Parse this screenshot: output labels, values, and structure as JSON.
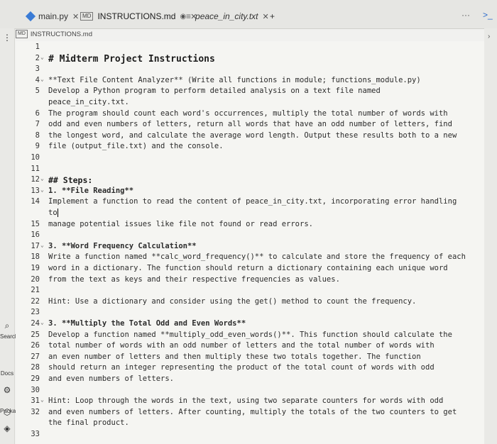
{
  "tabs": [
    {
      "label": "main.py",
      "icon": "python-diamond-icon",
      "active": false
    },
    {
      "label": "INSTRUCTIONS.md",
      "icon": "markdown-icon",
      "active": true
    },
    {
      "label": "peace_in_city.txt",
      "icon": "text-file-icon",
      "active": false
    }
  ],
  "tab_add": "+",
  "more_label": "···",
  "chevron_right": ">_",
  "breadcrumb": "INSTRUCTIONS.md",
  "left_strip": {
    "search": "Search",
    "docs": "Docs",
    "packages": "Packages"
  },
  "lines": [
    {
      "n": "1",
      "fold": "",
      "text": "",
      "style": ""
    },
    {
      "n": "2",
      "fold": "v",
      "text": "# Midterm Project Instructions",
      "style": "h1"
    },
    {
      "n": "3",
      "fold": "",
      "text": "",
      "style": ""
    },
    {
      "n": "4",
      "fold": "v",
      "text": "**Text File Content Analyzer** (Write all functions in module; functions_module.py)",
      "style": ""
    },
    {
      "n": "5",
      "fold": "",
      "text": "Develop a Python program to perform detailed analysis on a text file named",
      "style": ""
    },
    {
      "n": "",
      "fold": "",
      "text": "peace_in_city.txt.",
      "style": ""
    },
    {
      "n": "6",
      "fold": "",
      "text": "The program should count each word's occurrences, multiply the total number of words with",
      "style": ""
    },
    {
      "n": "7",
      "fold": "",
      "text": "odd and even numbers of letters, return all words that have an odd number of letters, find",
      "style": ""
    },
    {
      "n": "8",
      "fold": "",
      "text": "the longest word, and calculate the average word length. Output these results both to a new",
      "style": ""
    },
    {
      "n": "9",
      "fold": "",
      "text": "file (output_file.txt) and the console.",
      "style": ""
    },
    {
      "n": "10",
      "fold": "",
      "text": "",
      "style": ""
    },
    {
      "n": "11",
      "fold": "",
      "text": "",
      "style": ""
    },
    {
      "n": "12",
      "fold": "v",
      "text": "## Steps:",
      "style": "h2"
    },
    {
      "n": "13",
      "fold": "v",
      "text": "1. **File Reading**",
      "style": "bold"
    },
    {
      "n": "14",
      "fold": "",
      "text": "Implement a function to read the content of peace_in_city.txt, incorporating error handling",
      "style": ""
    },
    {
      "n": "",
      "fold": "",
      "text": "to",
      "style": "cursor"
    },
    {
      "n": "15",
      "fold": "",
      "text": "manage potential issues like file not found or read errors.",
      "style": ""
    },
    {
      "n": "16",
      "fold": "",
      "text": "",
      "style": ""
    },
    {
      "n": "17",
      "fold": "v",
      "text": "3. **Word Frequency Calculation**",
      "style": "bold"
    },
    {
      "n": "18",
      "fold": "",
      "text": "Write a function named **calc_word_frequency()** to calculate and store the frequency of each",
      "style": ""
    },
    {
      "n": "19",
      "fold": "",
      "text": "word in a dictionary. The function should return a dictionary containing each unique word",
      "style": ""
    },
    {
      "n": "20",
      "fold": "",
      "text": "from the text as keys and their respective frequencies as values.",
      "style": ""
    },
    {
      "n": "21",
      "fold": "",
      "text": "",
      "style": ""
    },
    {
      "n": "22",
      "fold": "",
      "text": "Hint: Use a dictionary and consider using the get() method to count the frequency.",
      "style": ""
    },
    {
      "n": "23",
      "fold": "",
      "text": "",
      "style": ""
    },
    {
      "n": "24",
      "fold": "v",
      "text": "3. **Multiply the Total Odd and Even Words**",
      "style": "bold"
    },
    {
      "n": "25",
      "fold": "",
      "text": "Develop a function named **multiply_odd_even_words()**. This function should calculate the",
      "style": ""
    },
    {
      "n": "26",
      "fold": "",
      "text": "total number of words with an odd number of letters and the total number of words with",
      "style": ""
    },
    {
      "n": "27",
      "fold": "",
      "text": "an even number of letters and then multiply these two totals together. The function",
      "style": ""
    },
    {
      "n": "28",
      "fold": "",
      "text": "should return an integer representing the product of the total count of words with odd",
      "style": ""
    },
    {
      "n": "29",
      "fold": "",
      "text": "and even numbers of letters.",
      "style": ""
    },
    {
      "n": "30",
      "fold": "",
      "text": "",
      "style": ""
    },
    {
      "n": "31",
      "fold": "v",
      "text": "Hint: Loop through the words in the text, using two separate counters for words with odd",
      "style": ""
    },
    {
      "n": "32",
      "fold": "",
      "text": "and even numbers of letters. After counting, multiply the totals of the two counters to get",
      "style": ""
    },
    {
      "n": "",
      "fold": "",
      "text": "the final product.",
      "style": ""
    },
    {
      "n": "33",
      "fold": "",
      "text": "",
      "style": ""
    }
  ]
}
